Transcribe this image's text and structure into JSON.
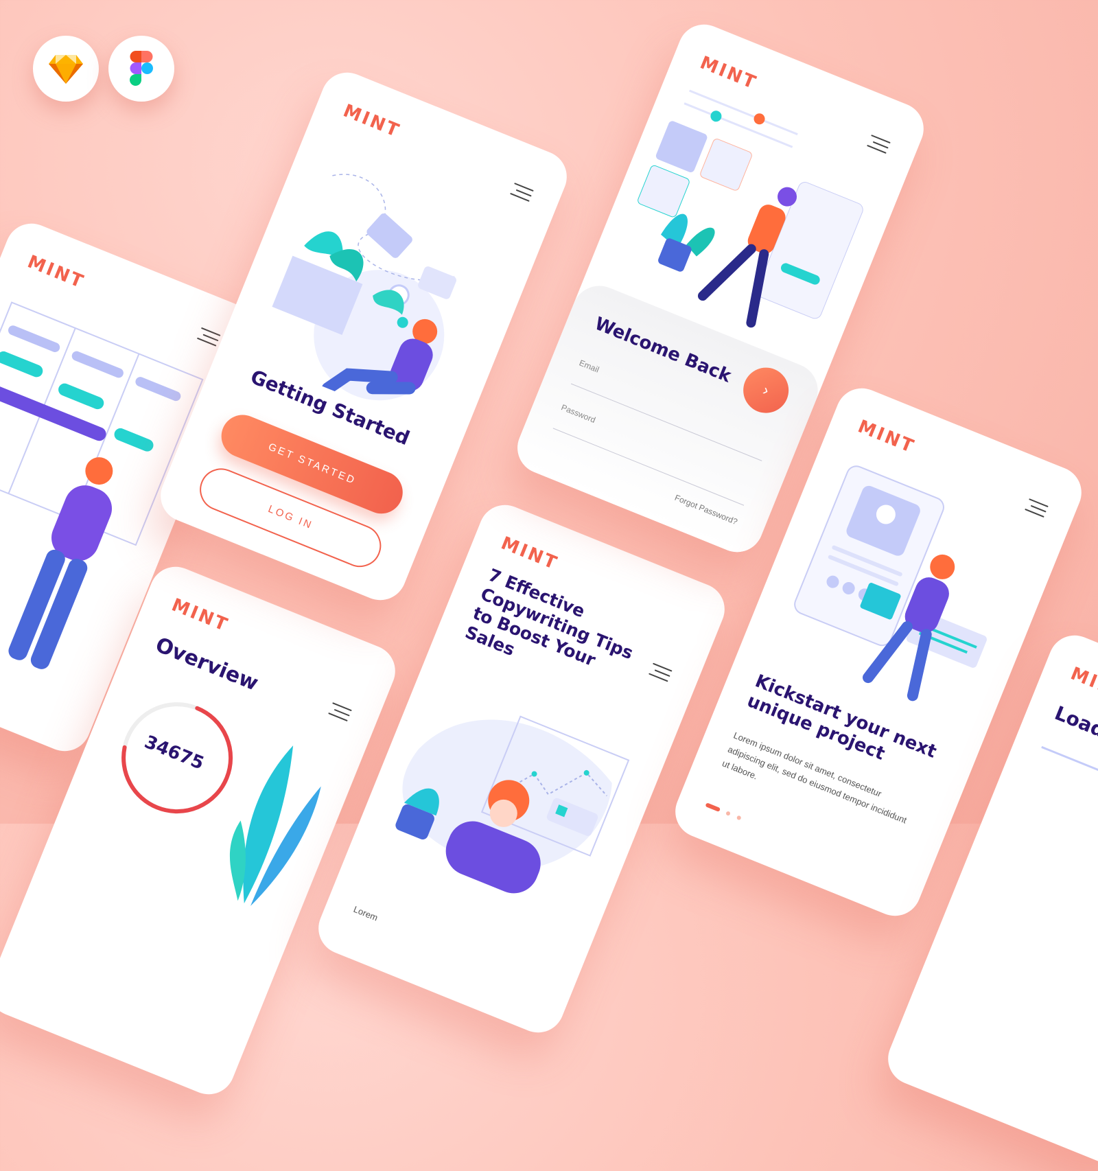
{
  "brand": {
    "logo": "mint",
    "accent": "#f2624d",
    "heading_color": "#2a1470",
    "teal": "#25d3cf",
    "purple": "#6c4ee0"
  },
  "tools": [
    {
      "icon": "sketch-icon"
    },
    {
      "icon": "figma-icon"
    }
  ],
  "getting_started": {
    "title": "Getting Started",
    "primary": "Get Started",
    "secondary": "Log In"
  },
  "login": {
    "title": "Welcome Back",
    "email_label": "Email",
    "password_label": "Password",
    "forgot": "Forgot Password?"
  },
  "blog": {
    "title": "7 Effective Copywriting Tips to Boost Your Sales",
    "snippet": "Lorem"
  },
  "overview": {
    "title": "Overview",
    "stat_value": "34675",
    "stat_ratio": 0.72
  },
  "kickstart": {
    "title": "Kickstart your next unique project",
    "body": "Lorem ipsum dolor sit amet, consectetur adipiscing elit, sed do eiusmod tempor incididunt ut labore."
  },
  "loading": {
    "title": "Loading"
  }
}
